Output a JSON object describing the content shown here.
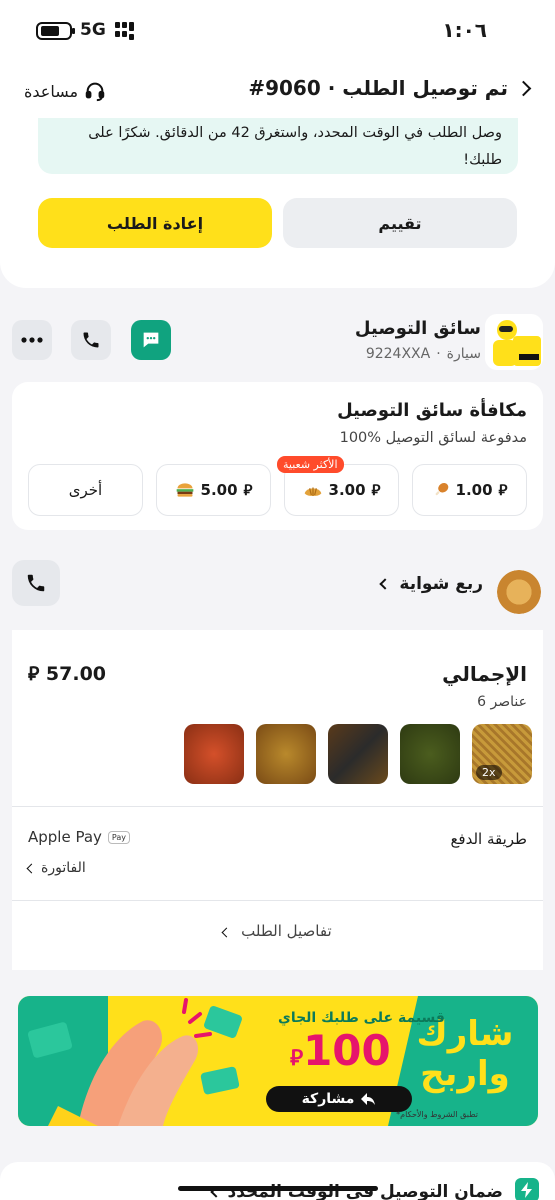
{
  "status_bar": {
    "time": "١:٠٦",
    "network": "5G"
  },
  "header": {
    "title": "#9060 · تم توصيل الطلب",
    "help_label": "مساعدة"
  },
  "delivery_note": {
    "text": "وصل الطلب في الوقت المحدد، واستغرق 42 من الدقائق. شكرًا على طلبك!"
  },
  "actions": {
    "rate_label": "تقييم",
    "reorder_label": "إعادة الطلب"
  },
  "driver": {
    "title": "سائق التوصيل",
    "vehicle": "سيارة",
    "plate": "9224XXA"
  },
  "tip": {
    "title": "مكافأة سائق التوصيل",
    "subtitle": "100% مدفوعة لسائق التوصيل",
    "badge": "الأكثر شعبية",
    "options": [
      {
        "amount": "1.00",
        "icon": "drumstick-icon"
      },
      {
        "amount": "3.00",
        "icon": "croissant-icon"
      },
      {
        "amount": "5.00",
        "icon": "burger-icon"
      },
      {
        "amount": "أخرى"
      }
    ]
  },
  "restaurant": {
    "name": "ربع شواية"
  },
  "receipt": {
    "total_label": "الإجمالي",
    "total_value": "57.00",
    "items_count": "6 عناصر",
    "first_item_qty": "2x",
    "payment_label": "طريقة الدفع",
    "payment_method": "Apple Pay",
    "apple_pay_mark": "Pay",
    "invoice_label": "الفاتورة",
    "details_label": "تفاصيل الطلب"
  },
  "promo": {
    "headline": "شارك واربح",
    "sub": "قسيمة على طلبك الجاي",
    "amount": "100",
    "share_label": "مشاركة",
    "terms": "*تطبق الشروط والأحكام"
  },
  "bottom": {
    "text": "ضمان التوصيل في الوقت المحدد"
  },
  "colors": {
    "accent_yellow": "#ffe01a",
    "green": "#17b38a",
    "promo_pink": "#e6156c",
    "badge_red": "#ff4b2b"
  }
}
